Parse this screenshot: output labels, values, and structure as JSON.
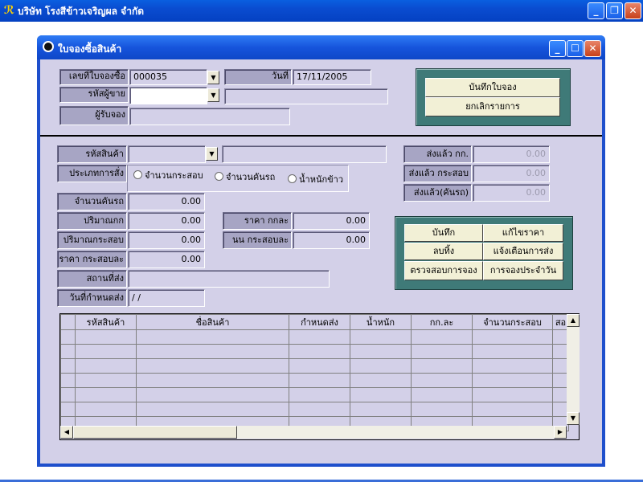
{
  "app": {
    "title": "บริษัท โรงสีข้าวเจริญผล จำกัด",
    "minimize": "_",
    "maximize": "❐",
    "close": "✕"
  },
  "window": {
    "title": "ใบจองซื้อสินค้า",
    "minimize": "_",
    "maximize": "☐",
    "close": "✕"
  },
  "header": {
    "order_no_label": "เลขที่ใบจองซื้อ",
    "order_no_value": "000035",
    "date_label": "วันที่",
    "date_value": "17/11/2005",
    "seller_code_label": "รหัสผู้ขาย",
    "seller_code_value": "",
    "seller_name_value": "",
    "receiver_label": "ผู้รับจอง",
    "receiver_value": ""
  },
  "top_buttons": {
    "save_order": "บันทึกใบจอง",
    "cancel_item": "ยกเลิกรายการ"
  },
  "product": {
    "code_label": "รหัสสินค้า",
    "code_value": "",
    "name_value": "",
    "order_type_label": "ประเภทการสั่ง",
    "radio_bags": "จำนวนกระสอบ",
    "radio_trucks": "จำนวนคันรถ",
    "radio_weight": "น้ำหนักข้าว"
  },
  "quantities": {
    "trucks_label": "จำนวนคันรถ",
    "trucks_value": "0.00",
    "amount_kg_label": "ปริมาณกก",
    "amount_kg_value": "0.00",
    "amount_bags_label": "ปริมาณกระสอบ",
    "amount_bags_value": "0.00",
    "price_per_bag_label": "ราคา กระสอบละ",
    "price_per_bag_value": "0.00",
    "price_per_kg_label": "ราคา กกละ",
    "price_per_kg_value": "0.00",
    "weight_per_bag_label": "นน กระสอบละ",
    "weight_per_bag_value": "0.00",
    "destination_label": "สถานที่ส่ง",
    "destination_value": "",
    "due_date_label": "วันที่กำหนดส่ง",
    "due_date_value": " / /"
  },
  "delivered": {
    "kg_label": "ส่งแล้ว กก.",
    "kg_value": "0.00",
    "bags_label": "ส่งแล้ว กระสอบ",
    "bags_value": "0.00",
    "trucks_label": "ส่งแล้ว(คันรถ)",
    "trucks_value": "0.00"
  },
  "action_buttons": {
    "save": "บันทึก",
    "edit_price": "แก้ไขราคา",
    "delete": "ลบทิ้ง",
    "notify_delivery": "แจ้งเตือนการส่ง",
    "check_booking": "ตรวจสอบการจอง",
    "daily_booking": "การจองประจำวัน"
  },
  "grid": {
    "columns": [
      "รหัสสินค้า",
      "ชื่อสินค้า",
      "กำหนดส่ง",
      "น้ำหนัก",
      "กก.ละ",
      "จำนวนกระสอบ",
      "สอ"
    ],
    "empty_rows": 7
  },
  "colors": {
    "form_bg": "#d3d0e8",
    "label_bg": "#a7a5c4",
    "panel_bg": "#3f7a78",
    "titlebar": "#0a4cd0"
  }
}
